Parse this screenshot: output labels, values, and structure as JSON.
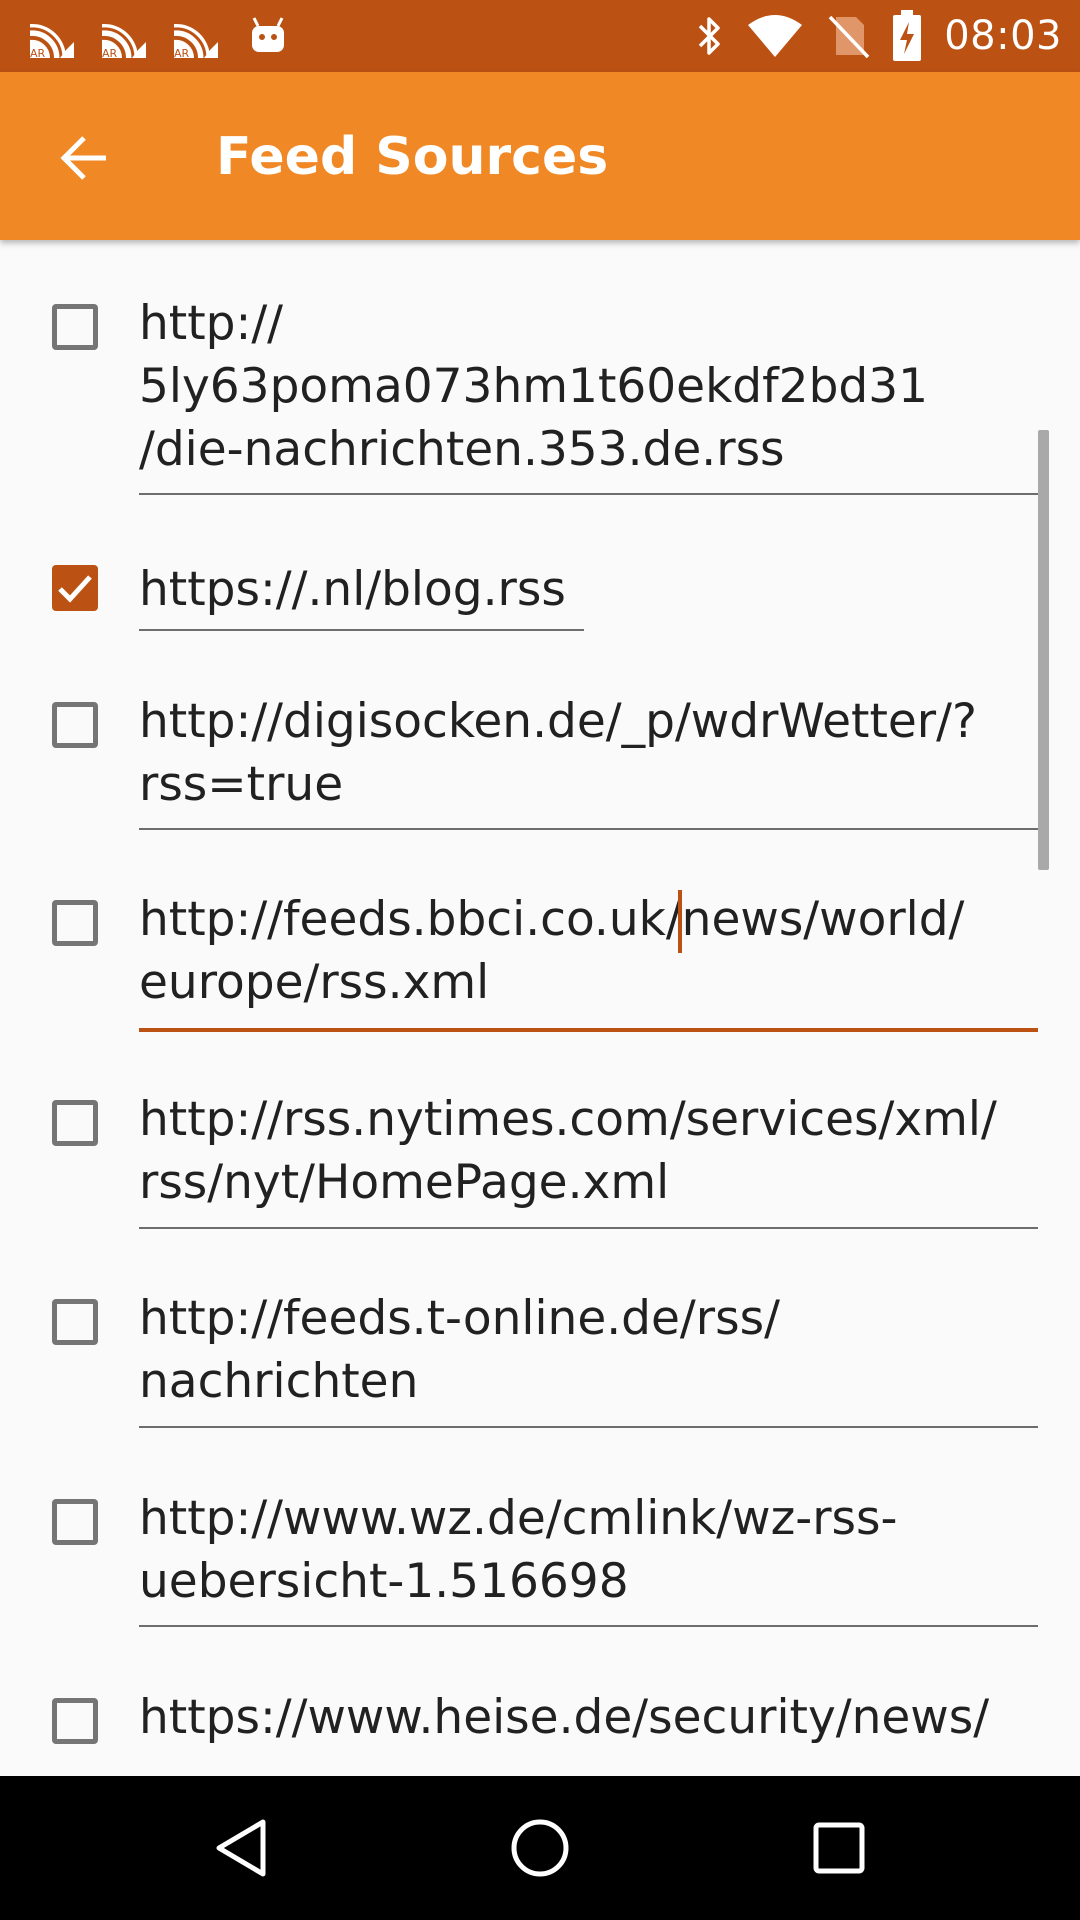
{
  "status_bar": {
    "notification_icons": [
      "ar-feed-icon",
      "ar-feed-icon",
      "ar-feed-icon",
      "android-icon"
    ],
    "notification_badges": [
      "AR",
      "AR",
      "AR"
    ],
    "time": "08:03"
  },
  "toolbar": {
    "title": "Feed Sources",
    "back_icon": "arrow-left-icon"
  },
  "feeds": [
    {
      "url": "http://\n5ly63poma073hm1t60ekdf2bd31\n/die-nachrichten.353.de.rss",
      "checked": false
    },
    {
      "url": "https://.nl/blog.rss",
      "checked": true
    },
    {
      "url": "http://digisocken.de/_p/wdrWetter/?\nrss=true",
      "checked": false
    },
    {
      "url": "http://feeds.bbci.co.uk/news/world/\neurope/rss.xml",
      "checked": false,
      "focused": true
    },
    {
      "url": "http://rss.nytimes.com/services/xml/\nrss/nyt/HomePage.xml",
      "checked": false
    },
    {
      "url": "http://feeds.t-online.de/rss/\nnachrichten",
      "checked": false
    },
    {
      "url": "http://www.wz.de/cmlink/wz-rss-\nuebersicht-1.516698",
      "checked": false
    },
    {
      "url": "https://www.heise.de/security/news/",
      "checked": false
    }
  ],
  "colors": {
    "status_bar": "#bb5213",
    "toolbar": "#f18826",
    "accent": "#bb5213",
    "background": "#fafafa"
  },
  "nav_bar": {
    "back": "nav-back-icon",
    "home": "nav-home-icon",
    "recents": "nav-recents-icon"
  }
}
